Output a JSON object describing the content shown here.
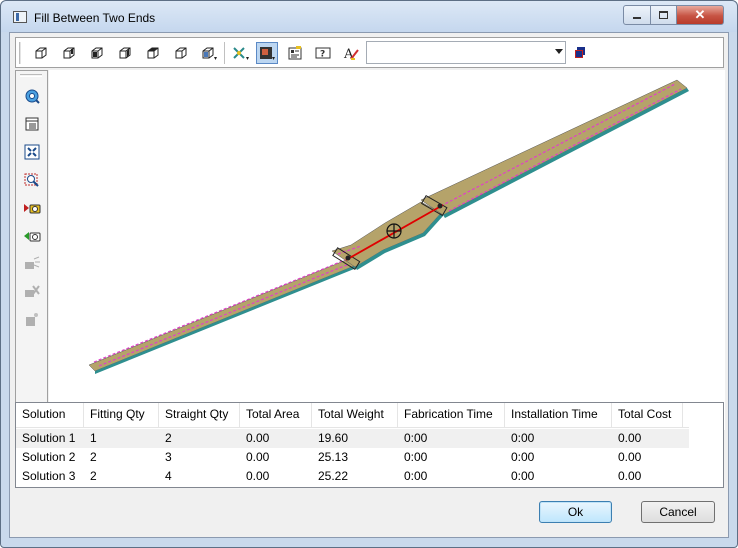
{
  "window": {
    "title": "Fill Between Two Ends"
  },
  "toolbar": {
    "combo_value": ""
  },
  "table": {
    "columns": [
      "Solution",
      "Fitting Qty",
      "Straight Qty",
      "Total Area",
      "Total Weight",
      "Fabrication Time",
      "Installation Time",
      "Total Cost"
    ],
    "rows": [
      [
        "Solution 1",
        "1",
        "2",
        "0.00",
        "19.60",
        "0:00",
        "0:00",
        "0.00"
      ],
      [
        "Solution 2",
        "2",
        "3",
        "0.00",
        "25.13",
        "0:00",
        "0:00",
        "0.00"
      ],
      [
        "Solution 3",
        "2",
        "4",
        "0.00",
        "25.22",
        "0:00",
        "0:00",
        "0.00"
      ]
    ]
  },
  "buttons": {
    "ok": "Ok",
    "cancel": "Cancel"
  },
  "colors": {
    "tray_fill": "#b5a36a",
    "tray_edge": "#2f8f8f",
    "rung_marks": "#e040c8",
    "selection_line": "#e00000",
    "accent": "#3c7fb1"
  }
}
